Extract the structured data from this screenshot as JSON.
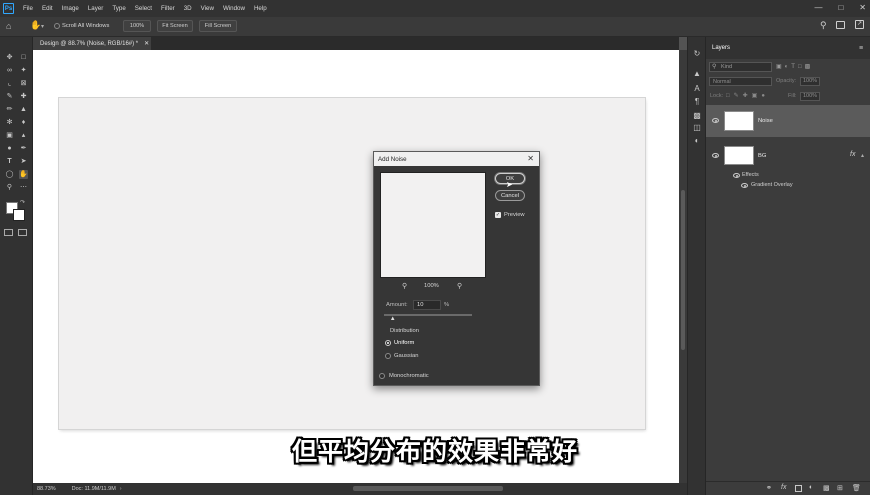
{
  "menubar": {
    "logo": "Ps",
    "items": [
      "File",
      "Edit",
      "Image",
      "Layer",
      "Type",
      "Select",
      "Filter",
      "3D",
      "View",
      "Window",
      "Help"
    ]
  },
  "options_bar": {
    "scroll_all_windows_label": "Scroll All Windows",
    "zoom_100_label": "100%",
    "fit_screen_label": "Fit Screen",
    "fill_screen_label": "Fill Screen"
  },
  "document": {
    "tab_title": "Design @ 88.7% (Noise, RGB/16#) *",
    "status_zoom": "88.73%",
    "status_doc": "Doc: 11.9M/11.9M"
  },
  "dialog": {
    "title": "Add Noise",
    "ok_label": "OK",
    "cancel_label": "Cancel",
    "preview_label": "Preview",
    "preview_checked": true,
    "zoom_value": "100%",
    "amount_label": "Amount:",
    "amount_value": "10",
    "amount_unit": "%",
    "amount_slider_fraction": 0.1,
    "distribution_label": "Distribution",
    "distribution_options": [
      "Uniform",
      "Gaussian"
    ],
    "distribution_selected": "Uniform",
    "monochromatic_label": "Monochromatic",
    "monochromatic_checked": false
  },
  "layers_panel": {
    "title": "Layers",
    "filter_placeholder": "Kind",
    "blend_mode": "Normal",
    "opacity_label": "Opacity:",
    "opacity_value": "100%",
    "lock_label": "Lock:",
    "fill_label": "Fill:",
    "fill_value": "100%",
    "layers": [
      {
        "name": "Noise",
        "selected": true
      },
      {
        "name": "BG",
        "selected": false,
        "fx": "fx"
      }
    ],
    "effects_label": "Effects",
    "effect_item": "Gradient Overlay"
  },
  "subtitle": "但平均分布的效果非常好",
  "colors": {
    "accent": "#31a8ff",
    "menubar": "#323232",
    "panel": "#3c3c3c",
    "canvas": "#ffffff"
  }
}
